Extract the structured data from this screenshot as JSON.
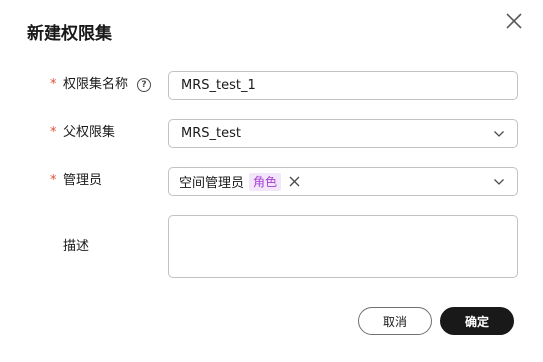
{
  "dialog": {
    "title": "新建权限集",
    "close_icon": "close-icon"
  },
  "form": {
    "name": {
      "label": "权限集名称",
      "required": "*",
      "help_icon": "question-circle-icon",
      "value": "MRS_test_1"
    },
    "parent": {
      "label": "父权限集",
      "required": "*",
      "value": "MRS_test",
      "dropdown_icon": "chevron-down-icon"
    },
    "admin": {
      "label": "管理员",
      "required": "*",
      "tag_text": "空间管理员",
      "tag_badge": "角色",
      "dropdown_icon": "chevron-down-icon"
    },
    "description": {
      "label": "描述",
      "value": ""
    }
  },
  "footer": {
    "cancel_label": "取消",
    "ok_label": "确定"
  },
  "colors": {
    "required": "#e84e40",
    "primary_button": "#191919",
    "badge_bg": "#f3e6fa",
    "badge_text": "#a43fd2",
    "border": "#c2c2c2"
  }
}
